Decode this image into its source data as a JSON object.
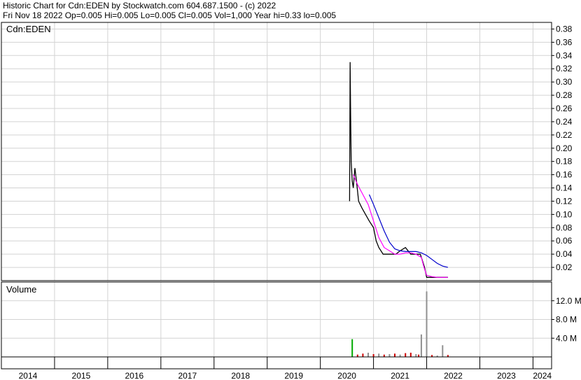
{
  "header": {
    "line1": "Historic Chart for Cdn:EDEN by Stockwatch.com 604.687.1500 - (c) 2022",
    "line2": "Fri Nov 18 2022  Op=0.005  Hi=0.005  Lo=0.005  Cl=0.005  Vol=1,000  Year hi=0.33  lo=0.005"
  },
  "colors": {
    "price": "#000000",
    "ma_short": "#ff00ff",
    "ma_long": "#0000cc",
    "grid": "#d3d3d3",
    "volume_down": "#cc0000",
    "volume_up": "#00aa00",
    "volume_neutral": "#909090"
  },
  "chart_data": [
    {
      "type": "line",
      "title": "Cdn:EDEN",
      "x_unit": "year",
      "xlim": [
        2014,
        2024.35
      ],
      "ylim": [
        0,
        0.39
      ],
      "y_ticks": [
        "0.02",
        "0.04",
        "0.06",
        "0.08",
        "0.10",
        "0.12",
        "0.14",
        "0.16",
        "0.18",
        "0.20",
        "0.22",
        "0.24",
        "0.26",
        "0.28",
        "0.30",
        "0.32",
        "0.34",
        "0.36",
        "0.38"
      ],
      "x_tick_labels": [
        "2014",
        "2015",
        "2016",
        "2017",
        "2018",
        "2019",
        "2020",
        "2021",
        "2022",
        "2023",
        "2024"
      ],
      "series": [
        {
          "x": [
            2020.55,
            2020.56,
            2020.57,
            2020.58,
            2020.6,
            2020.62,
            2020.65,
            2020.68,
            2020.72,
            2020.78,
            2020.85,
            2020.92,
            2021.0,
            2021.05,
            2021.1,
            2021.18,
            2021.25,
            2021.33,
            2021.42,
            2021.5,
            2021.6,
            2021.7,
            2021.8,
            2021.88,
            2021.92,
            2021.96,
            2022.0,
            2022.1,
            2022.2,
            2022.3,
            2022.4
          ],
          "y": [
            0.12,
            0.33,
            0.25,
            0.18,
            0.15,
            0.14,
            0.17,
            0.15,
            0.12,
            0.11,
            0.1,
            0.09,
            0.08,
            0.06,
            0.05,
            0.04,
            0.04,
            0.04,
            0.04,
            0.045,
            0.05,
            0.04,
            0.04,
            0.04,
            0.03,
            0.02,
            0.005,
            0.005,
            0.005,
            0.005,
            0.005
          ]
        },
        {
          "x": [
            2020.62,
            2020.7,
            2020.8,
            2020.9,
            2021.0,
            2021.1,
            2021.2,
            2021.3,
            2021.4,
            2021.5,
            2021.6,
            2021.7,
            2021.8,
            2021.9,
            2021.95,
            2022.0,
            2022.1,
            2022.2,
            2022.3,
            2022.4
          ],
          "y": [
            0.16,
            0.145,
            0.13,
            0.115,
            0.09,
            0.065,
            0.05,
            0.045,
            0.04,
            0.04,
            0.042,
            0.042,
            0.04,
            0.035,
            0.02,
            0.008,
            0.006,
            0.005,
            0.005,
            0.005
          ]
        },
        {
          "x": [
            2020.92,
            2021.0,
            2021.1,
            2021.2,
            2021.3,
            2021.4,
            2021.5,
            2021.6,
            2021.7,
            2021.8,
            2021.9,
            2022.0,
            2022.1,
            2022.2,
            2022.3,
            2022.4
          ],
          "y": [
            0.13,
            0.115,
            0.095,
            0.075,
            0.058,
            0.048,
            0.045,
            0.044,
            0.044,
            0.044,
            0.042,
            0.038,
            0.032,
            0.026,
            0.022,
            0.02
          ]
        }
      ]
    },
    {
      "type": "bar",
      "title": "Volume",
      "ylim": [
        0,
        16
      ],
      "y_ticks": [
        "4.0 M",
        "8.0 M",
        "12.0 M"
      ],
      "x": [
        2020.6,
        2020.7,
        2020.8,
        2020.9,
        2021.0,
        2021.1,
        2021.2,
        2021.3,
        2021.4,
        2021.5,
        2021.6,
        2021.7,
        2021.8,
        2021.85,
        2021.9,
        2022.0,
        2022.1,
        2022.2,
        2022.3,
        2022.4
      ],
      "values": [
        3.8,
        0.5,
        0.7,
        0.9,
        0.6,
        0.7,
        0.5,
        0.6,
        0.7,
        0.5,
        0.8,
        0.9,
        0.6,
        0.5,
        4.8,
        14.0,
        0.4,
        0.3,
        2.5,
        0.4
      ],
      "status": [
        "up",
        "down",
        "down",
        "neutral",
        "down",
        "neutral",
        "down",
        "neutral",
        "down",
        "neutral",
        "down",
        "down",
        "neutral",
        "down",
        "neutral",
        "neutral",
        "down",
        "neutral",
        "neutral",
        "down"
      ]
    }
  ]
}
